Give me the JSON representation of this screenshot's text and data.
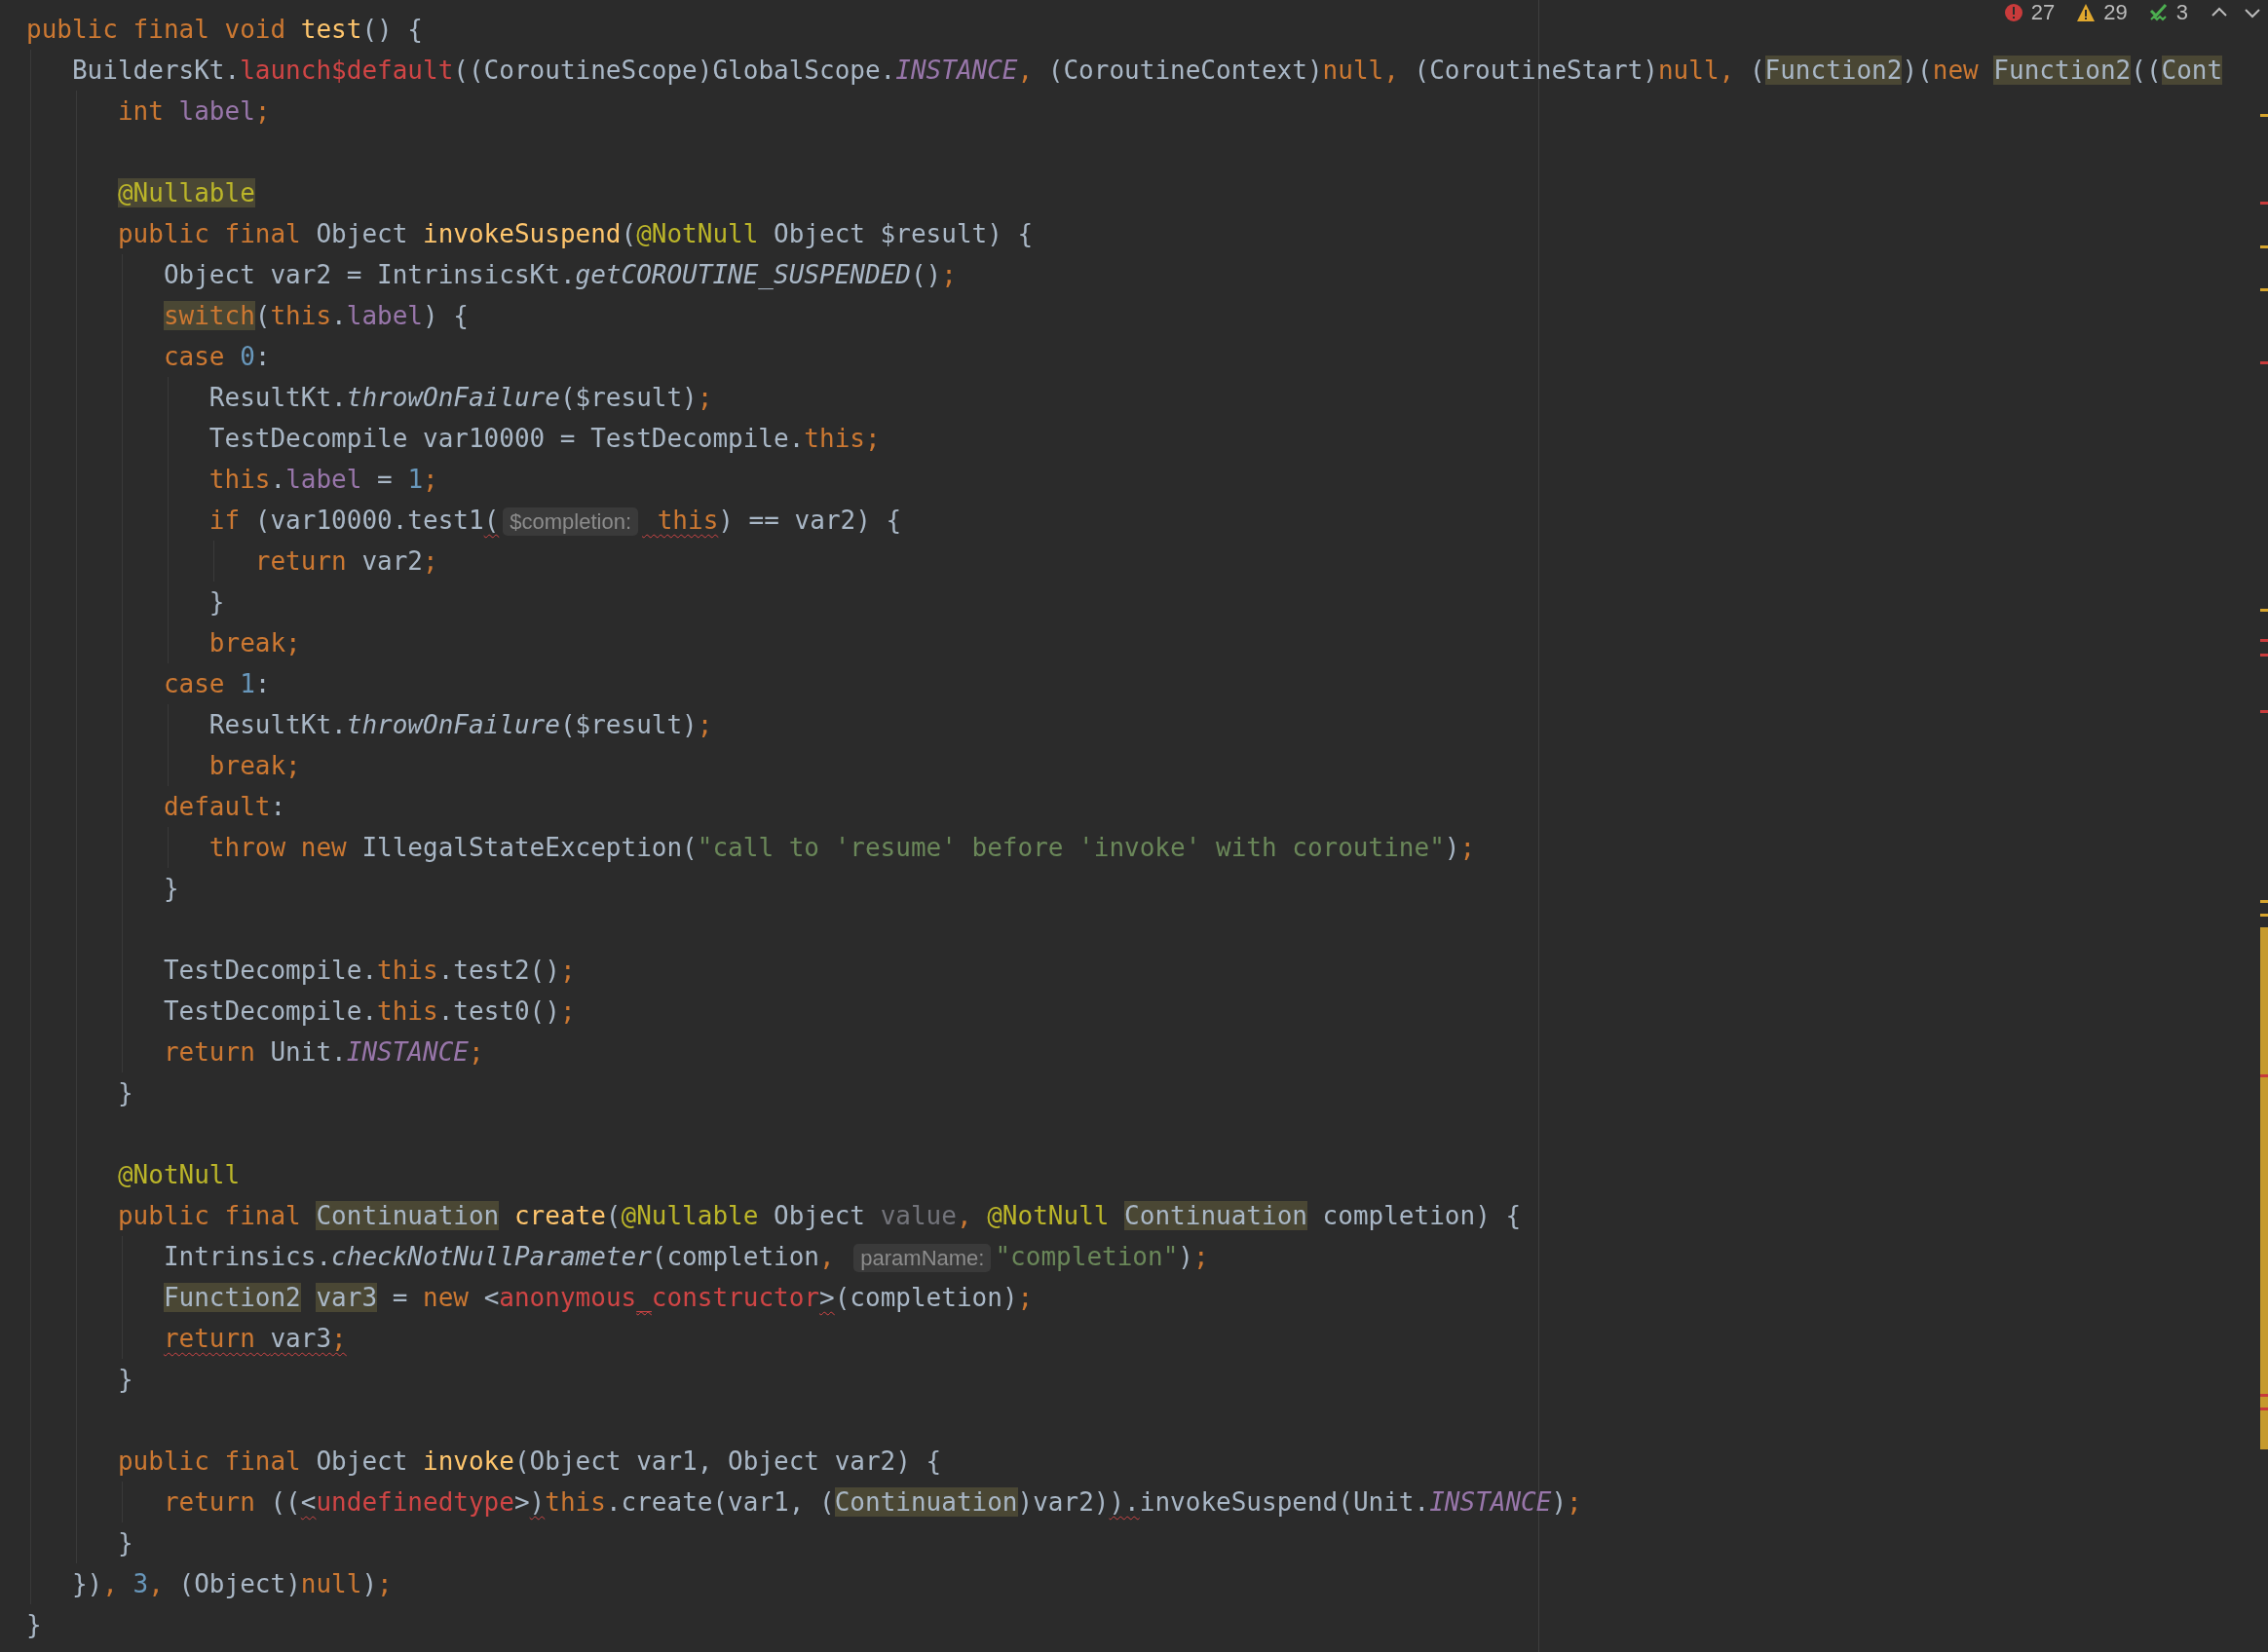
{
  "inspections": [
    {
      "kind": "error",
      "count": "27"
    },
    {
      "kind": "warning",
      "count": "29"
    },
    {
      "kind": "weak",
      "count": "3"
    }
  ],
  "lines": [
    {
      "kind": "code",
      "tokens": [
        {
          "kind": "kw",
          "t": "public final void "
        },
        {
          "kind": "fn",
          "t": "test"
        },
        {
          "kind": "p",
          "t": "() {"
        }
      ]
    },
    {
      "kind": "code",
      "tokens": [
        {
          "kind": "p",
          "t": "   BuildersKt."
        },
        {
          "kind": "err",
          "t": "launch$default"
        },
        {
          "kind": "p",
          "t": "((CoroutineScope)GlobalScope."
        },
        {
          "kind": "static",
          "t": "INSTANCE"
        },
        {
          "kind": "kw",
          "t": ", "
        },
        {
          "kind": "p",
          "t": "(CoroutineContext)"
        },
        {
          "kind": "kw",
          "t": "null, "
        },
        {
          "kind": "p",
          "t": "(CoroutineStart)"
        },
        {
          "kind": "kw",
          "t": "null, "
        },
        {
          "kind": "p",
          "t": "("
        },
        {
          "kind": "hl",
          "t": "Function2"
        },
        {
          "kind": "p",
          "t": ")("
        },
        {
          "kind": "kw",
          "t": "new "
        },
        {
          "kind": "hl",
          "t": "Function2"
        },
        {
          "kind": "p",
          "t": "(("
        },
        {
          "kind": "hl",
          "t": "Cont"
        }
      ]
    },
    {
      "kind": "code",
      "tokens": [
        {
          "kind": "kw",
          "t": "      int "
        },
        {
          "kind": "field",
          "t": "label"
        },
        {
          "kind": "kw",
          "t": ";"
        }
      ]
    },
    {
      "kind": "blank"
    },
    {
      "kind": "code",
      "tokens": [
        {
          "kind": "hlann",
          "t": "      @Nullable"
        }
      ]
    },
    {
      "kind": "code",
      "tokens": [
        {
          "kind": "kw",
          "t": "      public final "
        },
        {
          "kind": "p",
          "t": "Object "
        },
        {
          "kind": "fn",
          "t": "invokeSuspend"
        },
        {
          "kind": "p",
          "t": "("
        },
        {
          "kind": "ann",
          "t": "@NotNull"
        },
        {
          "kind": "p",
          "t": " Object $result) {"
        }
      ]
    },
    {
      "kind": "code",
      "tokens": [
        {
          "kind": "p",
          "t": "         Object var2 = IntrinsicsKt."
        },
        {
          "kind": "italic",
          "t": "getCOROUTINE_SUSPENDED"
        },
        {
          "kind": "p",
          "t": "()"
        },
        {
          "kind": "kw",
          "t": ";"
        }
      ]
    },
    {
      "kind": "code",
      "tokens": [
        {
          "kind": "hlkw",
          "t": "         switch"
        },
        {
          "kind": "p",
          "t": "("
        },
        {
          "kind": "kw",
          "t": "this"
        },
        {
          "kind": "p",
          "t": "."
        },
        {
          "kind": "field",
          "t": "label"
        },
        {
          "kind": "p",
          "t": ") {"
        }
      ]
    },
    {
      "kind": "code",
      "tokens": [
        {
          "kind": "kw",
          "t": "         case "
        },
        {
          "kind": "num",
          "t": "0"
        },
        {
          "kind": "p",
          "t": ":"
        }
      ]
    },
    {
      "kind": "code",
      "tokens": [
        {
          "kind": "p",
          "t": "            ResultKt."
        },
        {
          "kind": "italic",
          "t": "throwOnFailure"
        },
        {
          "kind": "p",
          "t": "($result)"
        },
        {
          "kind": "kw",
          "t": ";"
        }
      ]
    },
    {
      "kind": "code",
      "tokens": [
        {
          "kind": "p",
          "t": "            TestDecompile var10000 = TestDecompile."
        },
        {
          "kind": "kw",
          "t": "this;"
        }
      ]
    },
    {
      "kind": "code",
      "tokens": [
        {
          "kind": "kw",
          "t": "            this"
        },
        {
          "kind": "p",
          "t": "."
        },
        {
          "kind": "field",
          "t": "label"
        },
        {
          "kind": "p",
          "t": " = "
        },
        {
          "kind": "num",
          "t": "1"
        },
        {
          "kind": "kw",
          "t": ";"
        }
      ]
    },
    {
      "kind": "code",
      "tokens": [
        {
          "kind": "kw",
          "t": "            if "
        },
        {
          "kind": "p",
          "t": "(var10000.test1"
        },
        {
          "kind": "sq",
          "t": "("
        },
        {
          "kind": "hint",
          "t": "$completion:"
        },
        {
          "kind": "sqkw",
          "t": " this"
        },
        {
          "kind": "p",
          "t": ") == var2) {"
        }
      ]
    },
    {
      "kind": "code",
      "tokens": [
        {
          "kind": "kw",
          "t": "               return "
        },
        {
          "kind": "p",
          "t": "var2"
        },
        {
          "kind": "kw",
          "t": ";"
        }
      ]
    },
    {
      "kind": "code",
      "tokens": [
        {
          "kind": "p",
          "t": "            }"
        }
      ]
    },
    {
      "kind": "code",
      "tokens": [
        {
          "kind": "kw",
          "t": "            break;"
        }
      ]
    },
    {
      "kind": "code",
      "tokens": [
        {
          "kind": "kw",
          "t": "         case "
        },
        {
          "kind": "num",
          "t": "1"
        },
        {
          "kind": "p",
          "t": ":"
        }
      ]
    },
    {
      "kind": "code",
      "tokens": [
        {
          "kind": "p",
          "t": "            ResultKt."
        },
        {
          "kind": "italic",
          "t": "throwOnFailure"
        },
        {
          "kind": "p",
          "t": "($result)"
        },
        {
          "kind": "kw",
          "t": ";"
        }
      ]
    },
    {
      "kind": "code",
      "tokens": [
        {
          "kind": "kw",
          "t": "            break;"
        }
      ]
    },
    {
      "kind": "code",
      "tokens": [
        {
          "kind": "kw",
          "t": "         default"
        },
        {
          "kind": "p",
          "t": ":"
        }
      ]
    },
    {
      "kind": "code",
      "tokens": [
        {
          "kind": "kw",
          "t": "            throw new "
        },
        {
          "kind": "p",
          "t": "IllegalStateException("
        },
        {
          "kind": "str",
          "t": "\"call to 'resume' before 'invoke' with coroutine\""
        },
        {
          "kind": "p",
          "t": ")"
        },
        {
          "kind": "kw",
          "t": ";"
        }
      ]
    },
    {
      "kind": "code",
      "tokens": [
        {
          "kind": "p",
          "t": "         }"
        }
      ]
    },
    {
      "kind": "blank"
    },
    {
      "kind": "code",
      "tokens": [
        {
          "kind": "p",
          "t": "         TestDecompile."
        },
        {
          "kind": "kw",
          "t": "this"
        },
        {
          "kind": "p",
          "t": ".test2()"
        },
        {
          "kind": "kw",
          "t": ";"
        }
      ]
    },
    {
      "kind": "code",
      "tokens": [
        {
          "kind": "p",
          "t": "         TestDecompile."
        },
        {
          "kind": "kw",
          "t": "this"
        },
        {
          "kind": "p",
          "t": ".test0()"
        },
        {
          "kind": "kw",
          "t": ";"
        }
      ]
    },
    {
      "kind": "code",
      "tokens": [
        {
          "kind": "kw",
          "t": "         return "
        },
        {
          "kind": "p",
          "t": "Unit."
        },
        {
          "kind": "static",
          "t": "INSTANCE"
        },
        {
          "kind": "kw",
          "t": ";"
        }
      ]
    },
    {
      "kind": "code",
      "tokens": [
        {
          "kind": "p",
          "t": "      }"
        }
      ]
    },
    {
      "kind": "blank"
    },
    {
      "kind": "code",
      "tokens": [
        {
          "kind": "ann",
          "t": "      @NotNull"
        }
      ]
    },
    {
      "kind": "code",
      "tokens": [
        {
          "kind": "kw",
          "t": "      public final "
        },
        {
          "kind": "hl",
          "t": "Continuation"
        },
        {
          "kind": "fn",
          "t": " create"
        },
        {
          "kind": "p",
          "t": "("
        },
        {
          "kind": "ann",
          "t": "@Nullable"
        },
        {
          "kind": "p",
          "t": " Object "
        },
        {
          "kind": "unused",
          "t": "value"
        },
        {
          "kind": "kw",
          "t": ", "
        },
        {
          "kind": "ann",
          "t": "@NotNull "
        },
        {
          "kind": "hl",
          "t": "Continuation"
        },
        {
          "kind": "p",
          "t": " completion) {"
        }
      ]
    },
    {
      "kind": "code",
      "tokens": [
        {
          "kind": "p",
          "t": "         Intrinsics."
        },
        {
          "kind": "italic",
          "t": "checkNotNullParameter"
        },
        {
          "kind": "p",
          "t": "(completion"
        },
        {
          "kind": "kw",
          "t": ", "
        },
        {
          "kind": "hint",
          "t": "paramName:"
        },
        {
          "kind": "str",
          "t": "\"completion\""
        },
        {
          "kind": "p",
          "t": ")"
        },
        {
          "kind": "kw",
          "t": ";"
        }
      ]
    },
    {
      "kind": "code",
      "tokens": [
        {
          "kind": "hl",
          "t": "         Function2"
        },
        {
          "kind": "hl",
          "t": " var3"
        },
        {
          "kind": "p",
          "t": " = "
        },
        {
          "kind": "kw",
          "t": "new "
        },
        {
          "kind": "p",
          "t": "<"
        },
        {
          "kind": "err",
          "t": "anonymous"
        },
        {
          "kind": "sqerr",
          "t": "_"
        },
        {
          "kind": "err",
          "t": "constructor"
        },
        {
          "kind": "sq",
          "t": ">"
        },
        {
          "kind": "p",
          "t": "(completion)"
        },
        {
          "kind": "kw",
          "t": ";"
        }
      ]
    },
    {
      "kind": "code",
      "tokens": [
        {
          "kind": "sqkw",
          "t": "         return "
        },
        {
          "kind": "sq",
          "t": "var3"
        },
        {
          "kind": "sqkw",
          "t": ";"
        }
      ]
    },
    {
      "kind": "code",
      "tokens": [
        {
          "kind": "p",
          "t": "      }"
        }
      ]
    },
    {
      "kind": "blank"
    },
    {
      "kind": "code",
      "tokens": [
        {
          "kind": "kw",
          "t": "      public final "
        },
        {
          "kind": "p",
          "t": "Object "
        },
        {
          "kind": "fn",
          "t": "invoke"
        },
        {
          "kind": "p",
          "t": "(Object var1, Object var2) {"
        }
      ]
    },
    {
      "kind": "code",
      "tokens": [
        {
          "kind": "kw",
          "t": "         return "
        },
        {
          "kind": "p",
          "t": "(("
        },
        {
          "kind": "sq",
          "t": "<"
        },
        {
          "kind": "err",
          "t": "undefinedtype"
        },
        {
          "kind": "p",
          "t": ">"
        },
        {
          "kind": "sq",
          "t": ")"
        },
        {
          "kind": "kw",
          "t": "this"
        },
        {
          "kind": "p",
          "t": ".create(var1, ("
        },
        {
          "kind": "hl",
          "t": "Continuation"
        },
        {
          "kind": "p",
          "t": ")var2)"
        },
        {
          "kind": "sq",
          "t": ")."
        },
        {
          "kind": "p",
          "t": "invokeSuspend(Unit."
        },
        {
          "kind": "static",
          "t": "INSTANCE"
        },
        {
          "kind": "p",
          "t": ")"
        },
        {
          "kind": "kw",
          "t": ";"
        }
      ]
    },
    {
      "kind": "code",
      "tokens": [
        {
          "kind": "p",
          "t": "      }"
        }
      ]
    },
    {
      "kind": "code",
      "tokens": [
        {
          "kind": "p",
          "t": "   })"
        },
        {
          "kind": "kw",
          "t": ", "
        },
        {
          "kind": "num",
          "t": "3"
        },
        {
          "kind": "kw",
          "t": ", "
        },
        {
          "kind": "p",
          "t": "(Object)"
        },
        {
          "kind": "kw",
          "t": "null"
        },
        {
          "kind": "p",
          "t": ")"
        },
        {
          "kind": "kw",
          "t": ";"
        }
      ]
    },
    {
      "kind": "code",
      "tokens": [
        {
          "kind": "p",
          "t": "}"
        }
      ]
    }
  ]
}
